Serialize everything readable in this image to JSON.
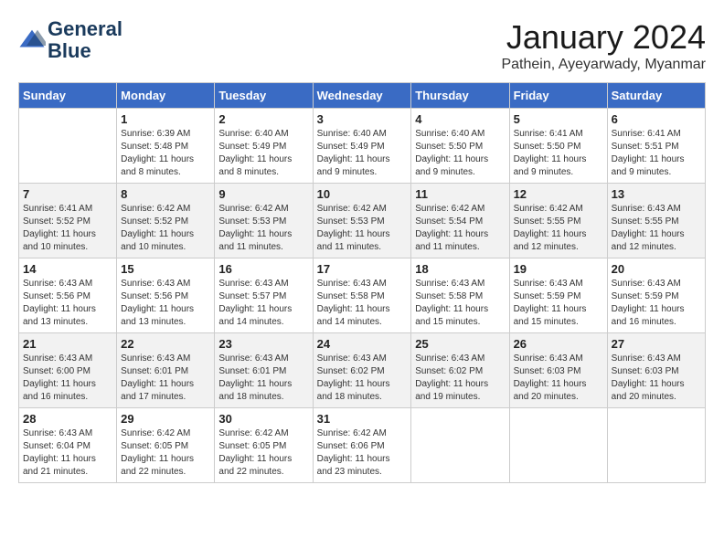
{
  "logo": {
    "line1": "General",
    "line2": "Blue"
  },
  "title": "January 2024",
  "subtitle": "Pathein, Ayeyarwady, Myanmar",
  "days_of_week": [
    "Sunday",
    "Monday",
    "Tuesday",
    "Wednesday",
    "Thursday",
    "Friday",
    "Saturday"
  ],
  "weeks": [
    [
      {
        "day": "",
        "info": ""
      },
      {
        "day": "1",
        "info": "Sunrise: 6:39 AM\nSunset: 5:48 PM\nDaylight: 11 hours\nand 8 minutes."
      },
      {
        "day": "2",
        "info": "Sunrise: 6:40 AM\nSunset: 5:49 PM\nDaylight: 11 hours\nand 8 minutes."
      },
      {
        "day": "3",
        "info": "Sunrise: 6:40 AM\nSunset: 5:49 PM\nDaylight: 11 hours\nand 9 minutes."
      },
      {
        "day": "4",
        "info": "Sunrise: 6:40 AM\nSunset: 5:50 PM\nDaylight: 11 hours\nand 9 minutes."
      },
      {
        "day": "5",
        "info": "Sunrise: 6:41 AM\nSunset: 5:50 PM\nDaylight: 11 hours\nand 9 minutes."
      },
      {
        "day": "6",
        "info": "Sunrise: 6:41 AM\nSunset: 5:51 PM\nDaylight: 11 hours\nand 9 minutes."
      }
    ],
    [
      {
        "day": "7",
        "info": "Sunrise: 6:41 AM\nSunset: 5:52 PM\nDaylight: 11 hours\nand 10 minutes."
      },
      {
        "day": "8",
        "info": "Sunrise: 6:42 AM\nSunset: 5:52 PM\nDaylight: 11 hours\nand 10 minutes."
      },
      {
        "day": "9",
        "info": "Sunrise: 6:42 AM\nSunset: 5:53 PM\nDaylight: 11 hours\nand 11 minutes."
      },
      {
        "day": "10",
        "info": "Sunrise: 6:42 AM\nSunset: 5:53 PM\nDaylight: 11 hours\nand 11 minutes."
      },
      {
        "day": "11",
        "info": "Sunrise: 6:42 AM\nSunset: 5:54 PM\nDaylight: 11 hours\nand 11 minutes."
      },
      {
        "day": "12",
        "info": "Sunrise: 6:42 AM\nSunset: 5:55 PM\nDaylight: 11 hours\nand 12 minutes."
      },
      {
        "day": "13",
        "info": "Sunrise: 6:43 AM\nSunset: 5:55 PM\nDaylight: 11 hours\nand 12 minutes."
      }
    ],
    [
      {
        "day": "14",
        "info": "Sunrise: 6:43 AM\nSunset: 5:56 PM\nDaylight: 11 hours\nand 13 minutes."
      },
      {
        "day": "15",
        "info": "Sunrise: 6:43 AM\nSunset: 5:56 PM\nDaylight: 11 hours\nand 13 minutes."
      },
      {
        "day": "16",
        "info": "Sunrise: 6:43 AM\nSunset: 5:57 PM\nDaylight: 11 hours\nand 14 minutes."
      },
      {
        "day": "17",
        "info": "Sunrise: 6:43 AM\nSunset: 5:58 PM\nDaylight: 11 hours\nand 14 minutes."
      },
      {
        "day": "18",
        "info": "Sunrise: 6:43 AM\nSunset: 5:58 PM\nDaylight: 11 hours\nand 15 minutes."
      },
      {
        "day": "19",
        "info": "Sunrise: 6:43 AM\nSunset: 5:59 PM\nDaylight: 11 hours\nand 15 minutes."
      },
      {
        "day": "20",
        "info": "Sunrise: 6:43 AM\nSunset: 5:59 PM\nDaylight: 11 hours\nand 16 minutes."
      }
    ],
    [
      {
        "day": "21",
        "info": "Sunrise: 6:43 AM\nSunset: 6:00 PM\nDaylight: 11 hours\nand 16 minutes."
      },
      {
        "day": "22",
        "info": "Sunrise: 6:43 AM\nSunset: 6:01 PM\nDaylight: 11 hours\nand 17 minutes."
      },
      {
        "day": "23",
        "info": "Sunrise: 6:43 AM\nSunset: 6:01 PM\nDaylight: 11 hours\nand 18 minutes."
      },
      {
        "day": "24",
        "info": "Sunrise: 6:43 AM\nSunset: 6:02 PM\nDaylight: 11 hours\nand 18 minutes."
      },
      {
        "day": "25",
        "info": "Sunrise: 6:43 AM\nSunset: 6:02 PM\nDaylight: 11 hours\nand 19 minutes."
      },
      {
        "day": "26",
        "info": "Sunrise: 6:43 AM\nSunset: 6:03 PM\nDaylight: 11 hours\nand 20 minutes."
      },
      {
        "day": "27",
        "info": "Sunrise: 6:43 AM\nSunset: 6:03 PM\nDaylight: 11 hours\nand 20 minutes."
      }
    ],
    [
      {
        "day": "28",
        "info": "Sunrise: 6:43 AM\nSunset: 6:04 PM\nDaylight: 11 hours\nand 21 minutes."
      },
      {
        "day": "29",
        "info": "Sunrise: 6:42 AM\nSunset: 6:05 PM\nDaylight: 11 hours\nand 22 minutes."
      },
      {
        "day": "30",
        "info": "Sunrise: 6:42 AM\nSunset: 6:05 PM\nDaylight: 11 hours\nand 22 minutes."
      },
      {
        "day": "31",
        "info": "Sunrise: 6:42 AM\nSunset: 6:06 PM\nDaylight: 11 hours\nand 23 minutes."
      },
      {
        "day": "",
        "info": ""
      },
      {
        "day": "",
        "info": ""
      },
      {
        "day": "",
        "info": ""
      }
    ]
  ]
}
